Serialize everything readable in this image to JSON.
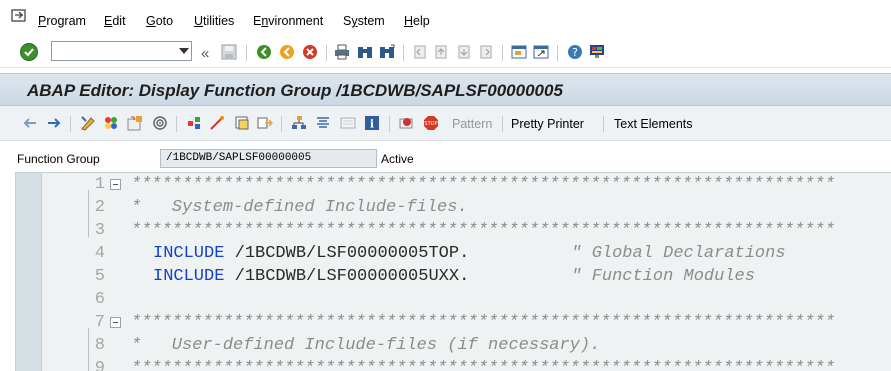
{
  "menu": {
    "items": [
      {
        "label": "Program",
        "u": "P",
        "rest": "rogram"
      },
      {
        "label": "Edit",
        "u": "E",
        "rest": "dit"
      },
      {
        "label": "Goto",
        "u": "G",
        "rest": "oto"
      },
      {
        "label": "Utilities",
        "u": "U",
        "rest": "tilities"
      },
      {
        "label": "Environment",
        "u": "n",
        "pre": "E",
        "rest": "vironment"
      },
      {
        "label": "System",
        "u": "y",
        "pre": "S",
        "rest": "stem"
      },
      {
        "label": "Help",
        "u": "H",
        "rest": "elp"
      }
    ]
  },
  "system_toolbar": {
    "command_field_value": "",
    "icons": [
      "enter-icon",
      "back-icon",
      "save-icon",
      "back-green-icon",
      "exit-icon",
      "cancel-icon",
      "print-icon",
      "find-icon",
      "find-next-icon",
      "first-page-icon",
      "previous-page-icon",
      "next-page-icon",
      "last-page-icon",
      "create-session-icon",
      "shortcut-icon",
      "help-icon",
      "customize-layout-icon"
    ]
  },
  "title": "ABAP Editor: Display Function Group /1BCDWB/SAPLSF00000005",
  "app_toolbar": {
    "pattern_label": "Pattern",
    "pretty_printer_label": "Pretty Printer",
    "text_elements_label": "Text Elements"
  },
  "function_group": {
    "label": "Function Group",
    "value": "/1BCDWB/SAPLSF00000005",
    "status": "Active"
  },
  "code_lines": [
    {
      "num": "1",
      "text": "*********************************************************************"
    },
    {
      "num": "2",
      "text": "*   System-defined Include-files."
    },
    {
      "num": "3",
      "text": "*********************************************************************"
    },
    {
      "num": "4",
      "kw": "INCLUDE",
      "path": " /1BCDWB/LSF00000005TOP",
      "dot": ".",
      "pad": "          ",
      "comment": "\" Global Declarations"
    },
    {
      "num": "5",
      "kw": "INCLUDE",
      "path": " /1BCDWB/LSF00000005UXX",
      "dot": ".",
      "pad": "          ",
      "comment": "\" Function Modules"
    },
    {
      "num": "6",
      "text": ""
    },
    {
      "num": "7",
      "text": "*********************************************************************"
    },
    {
      "num": "8",
      "text": "*   User-defined Include-files (if necessary)."
    },
    {
      "num": "9",
      "text": "*********************************************************************"
    }
  ]
}
